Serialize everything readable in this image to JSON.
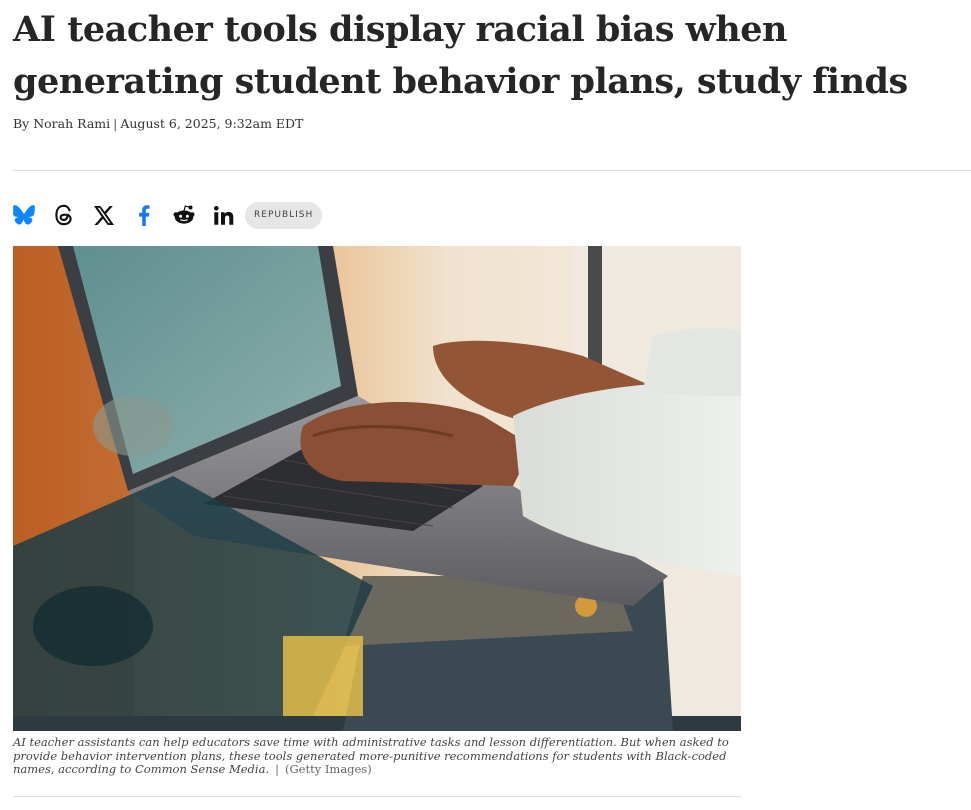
{
  "article": {
    "headline": "AI teacher tools display racial bias when generating student behavior plans, study finds",
    "byline": {
      "author": "By Norah Rami",
      "separator": "|",
      "date": "August 6, 2025, 9:32am EDT"
    }
  },
  "share": {
    "icons": [
      "bluesky-icon",
      "threads-icon",
      "x-icon",
      "facebook-icon",
      "reddit-icon",
      "linkedin-icon"
    ],
    "republish_label": "REPUBLISH"
  },
  "image": {
    "caption": "AI teacher assistants can help educators save time with administrative tasks and lesson differentiation. But when asked to provide behavior intervention plans, these tools generated more-punitive recommendations for students with Black-coded names, according to Common Sense Media.",
    "separator": "|",
    "credit": "(Getty Images)"
  },
  "colors": {
    "bluesky": "#1185fe",
    "facebook": "#1877f2",
    "headline": "#262626"
  }
}
